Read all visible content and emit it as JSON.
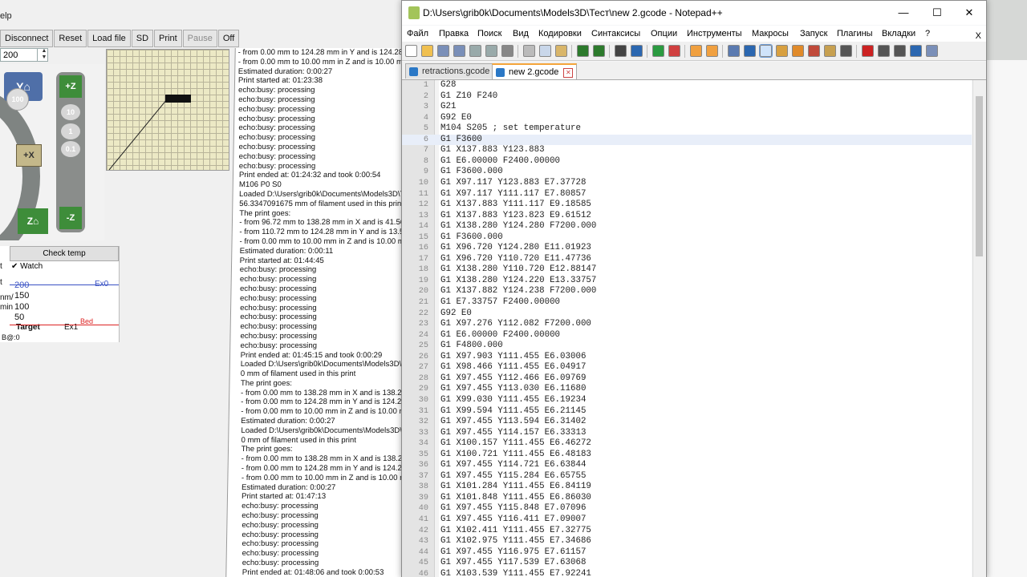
{
  "printer_app": {
    "menu_fragment": "elp",
    "toolbar": [
      {
        "label": "Disconnect",
        "enabled": true
      },
      {
        "label": "Reset",
        "enabled": true
      },
      {
        "label": "Load file",
        "enabled": true
      },
      {
        "label": "SD",
        "enabled": true
      },
      {
        "label": "Print",
        "enabled": true
      },
      {
        "label": "Pause",
        "enabled": false
      },
      {
        "label": "Off",
        "enabled": true
      }
    ],
    "speed_value": "200",
    "jog": {
      "y_label": "Y",
      "x_label": "+X",
      "z_home_label": "Z",
      "ring_label": "100",
      "z_plus_label": "+Z",
      "z_minus_label": "-Z",
      "z_steps": [
        "10",
        "1",
        "0.1"
      ]
    },
    "temp": {
      "check_temp_label": "Check temp",
      "watch_label": "Watch",
      "left_fragments": [
        "t",
        "t",
        "nm/",
        "min"
      ],
      "graph_labels": [
        "200",
        "150",
        "100",
        "50"
      ],
      "target_label": "Target",
      "ex0_label": "Ex0",
      "ex1_label": "Ex1",
      "bed_label": "Bed",
      "footer": "B@:0"
    },
    "log_lines": [
      "- from 0.00 mm to 124.28 mm in Y and is 124.28",
      "- from 0.00 mm to 10.00 mm in Z and is 10.00 mm",
      "Estimated duration: 0:00:27",
      "Print started at: 01:23:38",
      "echo:busy: processing",
      "echo:busy: processing",
      "echo:busy: processing",
      "echo:busy: processing",
      "echo:busy: processing",
      "echo:busy: processing",
      "echo:busy: processing",
      "echo:busy: processing",
      "echo:busy: processing",
      "Print ended at: 01:24:32 and took 0:00:54",
      "M106 P0 S0",
      "Loaded D:\\Users\\grib0k\\Documents\\Models3D\\T",
      "56.3347091675 mm of filament used in this print",
      "The print goes:",
      "- from 96.72 mm to 138.28 mm in X and is 41.56",
      "- from 110.72 mm to 124.28 mm in Y and is 13.5",
      "- from 0.00 mm to 10.00 mm in Z and is 10.00 mm",
      "Estimated duration: 0:00:11",
      "Print started at: 01:44:45",
      "echo:busy: processing",
      "echo:busy: processing",
      "echo:busy: processing",
      "echo:busy: processing",
      "echo:busy: processing",
      "echo:busy: processing",
      "echo:busy: processing",
      "echo:busy: processing",
      "echo:busy: processing",
      "Print ended at: 01:45:15 and took 0:00:29",
      "Loaded D:\\Users\\grib0k\\Documents\\Models3D\\T",
      "0 mm of filament used in this print",
      "The print goes:",
      "- from 0.00 mm to 138.28 mm in X and is 138.28",
      "- from 0.00 mm to 124.28 mm in Y and is 124.28",
      "- from 0.00 mm to 10.00 mm in Z and is 10.00 mm",
      "Estimated duration: 0:00:27",
      "Loaded D:\\Users\\grib0k\\Documents\\Models3D\\T",
      "0 mm of filament used in this print",
      "The print goes:",
      "- from 0.00 mm to 138.28 mm in X and is 138.28",
      "- from 0.00 mm to 124.28 mm in Y and is 124.28",
      "- from 0.00 mm to 10.00 mm in Z and is 10.00 mm",
      "Estimated duration: 0:00:27",
      "Print started at: 01:47:13",
      "echo:busy: processing",
      "echo:busy: processing",
      "echo:busy: processing",
      "echo:busy: processing",
      "echo:busy: processing",
      "echo:busy: processing",
      "echo:busy: processing",
      "Print ended at: 01:48:06 and took 0:00:53",
      "Loaded D:\\Users\\grib0k\\Documents\\Models3D\\T",
      "56.3347091675 mm of filament used in this print"
    ]
  },
  "notepad": {
    "title": "D:\\Users\\grib0k\\Documents\\Models3D\\Тест\\new 2.gcode - Notepad++",
    "window_controls": {
      "minimize": "—",
      "maximize": "☐",
      "close": "✕"
    },
    "menus": [
      "Файл",
      "Правка",
      "Поиск",
      "Вид",
      "Кодировки",
      "Синтаксисы",
      "Опции",
      "Инструменты",
      "Макросы",
      "Запуск",
      "Плагины",
      "Вкладки",
      "?"
    ],
    "close_doc": "X",
    "tabs": [
      {
        "label": "retractions.gcode",
        "active": false
      },
      {
        "label": "new 2.gcode",
        "active": true
      }
    ],
    "current_line": 6,
    "lines": [
      "G28",
      "G1 Z10 F240",
      "G21",
      "G92 E0",
      "M104 S205 ; set temperature",
      "G1 F3600",
      "G1 X137.883 Y123.883",
      "G1 E6.00000 F2400.00000",
      "G1 F3600.000",
      "G1 X97.117 Y123.883 E7.37728",
      "G1 X97.117 Y111.117 E7.80857",
      "G1 X137.883 Y111.117 E9.18585",
      "G1 X137.883 Y123.823 E9.61512",
      "G1 X138.280 Y124.280 F7200.000",
      "G1 F3600.000",
      "G1 X96.720 Y124.280 E11.01923",
      "G1 X96.720 Y110.720 E11.47736",
      "G1 X138.280 Y110.720 E12.88147",
      "G1 X138.280 Y124.220 E13.33757",
      "G1 X137.882 Y124.238 F7200.000",
      "G1 E7.33757 F2400.00000",
      "G92 E0",
      "G1 X97.276 Y112.082 F7200.000",
      "G1 E6.00000 F2400.00000",
      "G1 F4800.000",
      "G1 X97.903 Y111.455 E6.03006",
      "G1 X98.466 Y111.455 E6.04917",
      "G1 X97.455 Y112.466 E6.09769",
      "G1 X97.455 Y113.030 E6.11680",
      "G1 X99.030 Y111.455 E6.19234",
      "G1 X99.594 Y111.455 E6.21145",
      "G1 X97.455 Y113.594 E6.31402",
      "G1 X97.455 Y114.157 E6.33313",
      "G1 X100.157 Y111.455 E6.46272",
      "G1 X100.721 Y111.455 E6.48183",
      "G1 X97.455 Y114.721 E6.63844",
      "G1 X97.455 Y115.284 E6.65755",
      "G1 X101.284 Y111.455 E6.84119",
      "G1 X101.848 Y111.455 E6.86030",
      "G1 X97.455 Y115.848 E7.07096",
      "G1 X97.455 Y116.411 E7.09007",
      "G1 X102.411 Y111.455 E7.32775",
      "G1 X102.975 Y111.455 E7.34686",
      "G1 X97.455 Y116.975 E7.61157",
      "G1 X97.455 Y117.539 E7.63068",
      "G1 X103.539 Y111.455 E7.92241"
    ]
  }
}
